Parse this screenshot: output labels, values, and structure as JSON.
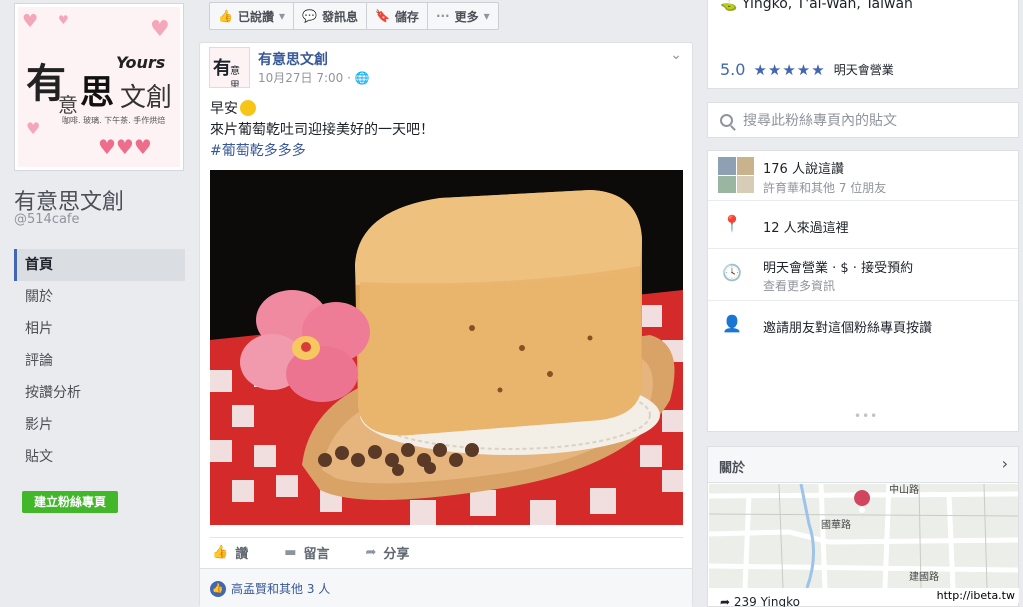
{
  "page": {
    "avatar": {
      "logo_main_1": "有",
      "logo_small": "意",
      "logo_main_2": "思",
      "logo_wen": "文創",
      "logo_yours": "Yours",
      "logo_tagline": "咖啡. 玻璃. 下午茶. 手作烘焙"
    },
    "name": "有意思文創",
    "handle": "@514cafe",
    "nav": [
      "首頁",
      "關於",
      "相片",
      "評論",
      "按讚分析",
      "影片",
      "貼文"
    ],
    "create_button": "建立粉絲專頁"
  },
  "toolbar": {
    "liked": "已說讚",
    "message": "發訊息",
    "save": "儲存",
    "more": "更多"
  },
  "post": {
    "author": "有意思文創",
    "time": "10月27日 7:00 · ",
    "avatar_1": "有",
    "avatar_2": "意思",
    "line1": "早安",
    "line2": "來片葡萄乾吐司迎接美好的一天吧！",
    "hashtag": "#葡萄乾多多多",
    "actions": {
      "like": "讚",
      "comment": "留言",
      "share": "分享"
    },
    "likes_summary": "高孟賢和其他 3 人"
  },
  "right": {
    "location": "Yingko, T'ai-Wan, Taiwan",
    "rating": "5.0",
    "stars": "★★★★★",
    "open_status": "明天會營業",
    "search_placeholder": "搜尋此粉絲專頁內的貼文",
    "likes_main": "176 人說這讚",
    "likes_sub": "許育華和其他 7 位朋友",
    "checkins": "12 人來過這裡",
    "hours_main": "明天會營業 · $ · 接受預約",
    "hours_sub": "查看更多資訊",
    "invite": "邀請朋友對這個粉絲專頁按讚",
    "dots": "•••",
    "about_title": "關於",
    "map_road_1": "中山路",
    "map_road_2": "國華路",
    "map_road_3": "建國路",
    "address": "239 Yingko"
  },
  "watermark": "http://ibeta.tw"
}
